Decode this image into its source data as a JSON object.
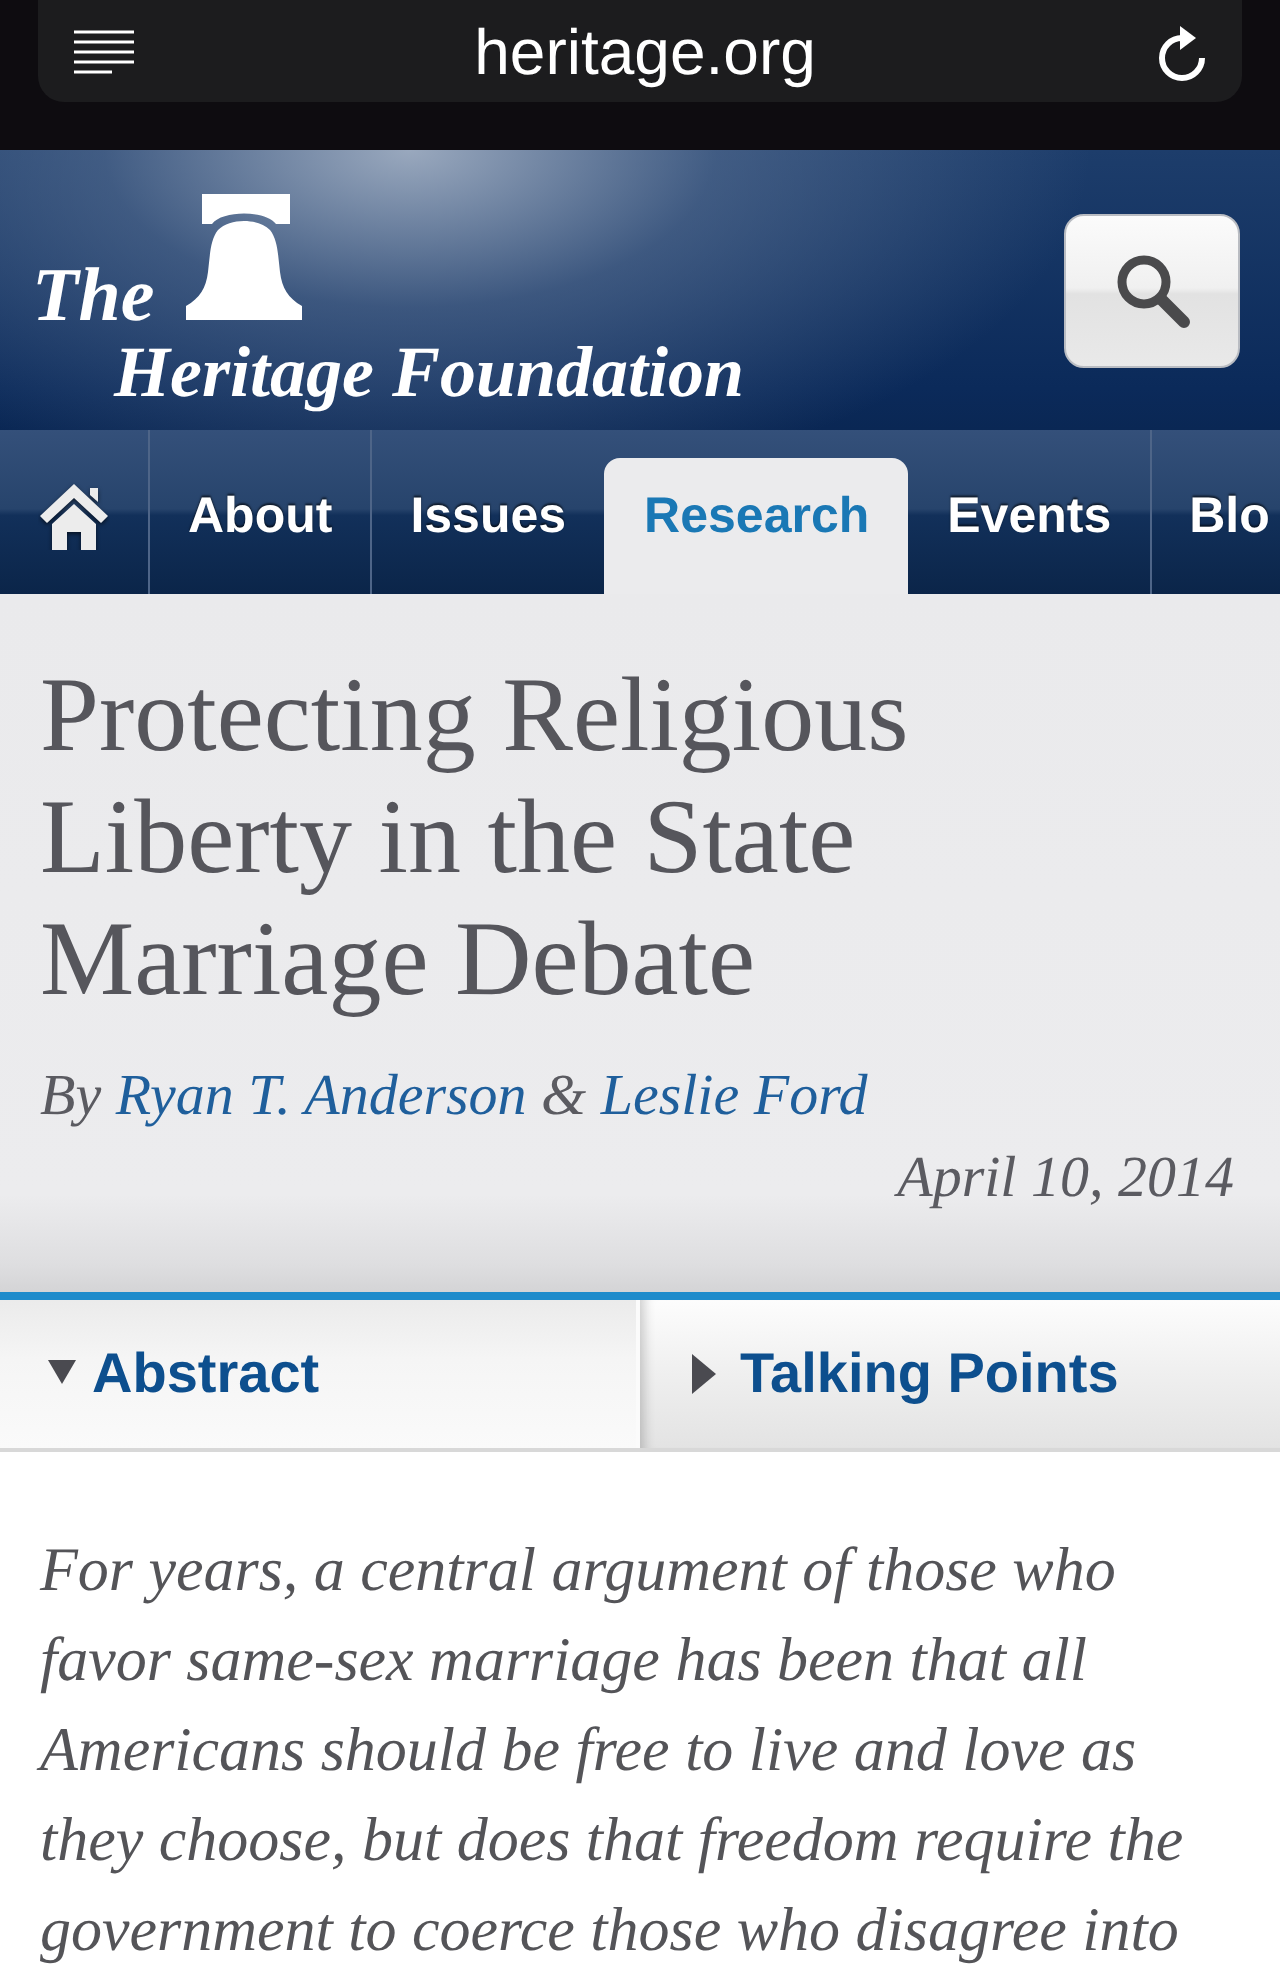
{
  "browser_bar": {
    "url": "heritage.org"
  },
  "header": {
    "logo_top": "The",
    "logo_bottom": "Heritage Foundation"
  },
  "nav_tabs": [
    {
      "kind": "home",
      "selected": false
    },
    {
      "kind": "text",
      "label": "About",
      "selected": false
    },
    {
      "kind": "text",
      "label": "Issues",
      "selected": false
    },
    {
      "kind": "text",
      "label": "Research",
      "selected": true
    },
    {
      "kind": "text",
      "label": "Events",
      "selected": false
    },
    {
      "kind": "text",
      "label": "Blo",
      "selected": false
    }
  ],
  "article": {
    "title": "Protecting Religious Liberty in the State Marriage Debate",
    "byline": {
      "prefix": "By",
      "authors": [
        "Ryan T. Anderson",
        "Leslie Ford"
      ],
      "joiner": "&"
    },
    "date": "April 10, 2014"
  },
  "section_tabs": [
    {
      "label": "Abstract",
      "expanded": true
    },
    {
      "label": "Talking Points",
      "expanded": false
    }
  ],
  "abstract": "For years, a central argument of those who favor same-sex marriage has been that all Americans should be free to live and love as they choose, but does that freedom require the government to coerce those who disagree into"
}
